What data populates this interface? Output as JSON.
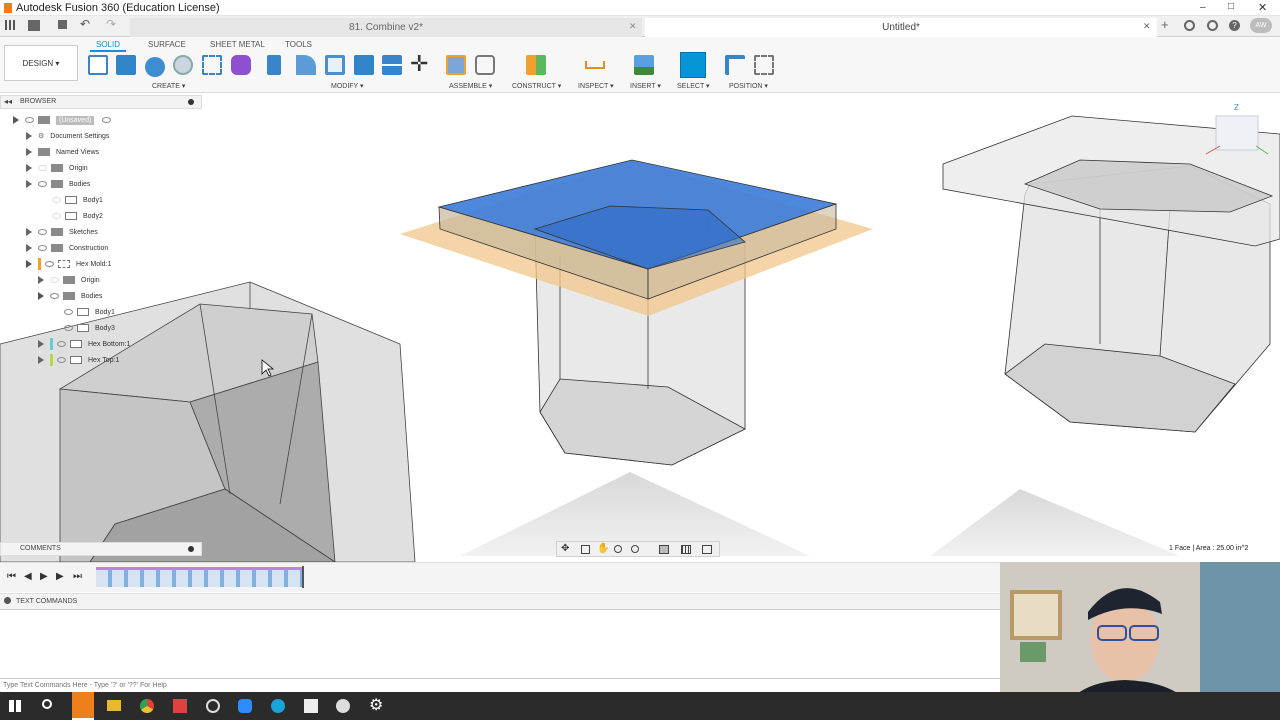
{
  "window": {
    "title": "Autodesk Fusion 360 (Education License)"
  },
  "doc_tabs": [
    {
      "label": "81. Combine v2*"
    },
    {
      "label": "Untitled*"
    }
  ],
  "workspace": {
    "label": "DESIGN"
  },
  "toolbar_tabs": [
    "SOLID",
    "SURFACE",
    "SHEET METAL",
    "TOOLS"
  ],
  "groups": [
    "CREATE",
    "MODIFY",
    "ASSEMBLE",
    "CONSTRUCT",
    "INSPECT",
    "INSERT",
    "SELECT",
    "POSITION"
  ],
  "browser": {
    "title": "BROWSER",
    "items": [
      "(Unsaved)",
      "Document Settings",
      "Named Views",
      "Origin",
      "Bodies",
      "Body1",
      "Body2",
      "Sketches",
      "Construction",
      "Hex Mold:1",
      "Origin",
      "Bodies",
      "Body1",
      "Body3",
      "Hex Bottom:1",
      "Hex Top:1"
    ]
  },
  "comments": {
    "title": "COMMENTS"
  },
  "status": {
    "face_area": "1 Face | Area : 25.00 in^2"
  },
  "textcommands": {
    "title": "TEXT COMMANDS",
    "placeholder": "Type Text Commands Here - Type '?' or '??' For Help"
  },
  "user": {
    "initials": "AW"
  },
  "colors": {
    "accent": "#0696d7",
    "selected_face": "#3b7bd9",
    "plane": "#f2c78b"
  }
}
